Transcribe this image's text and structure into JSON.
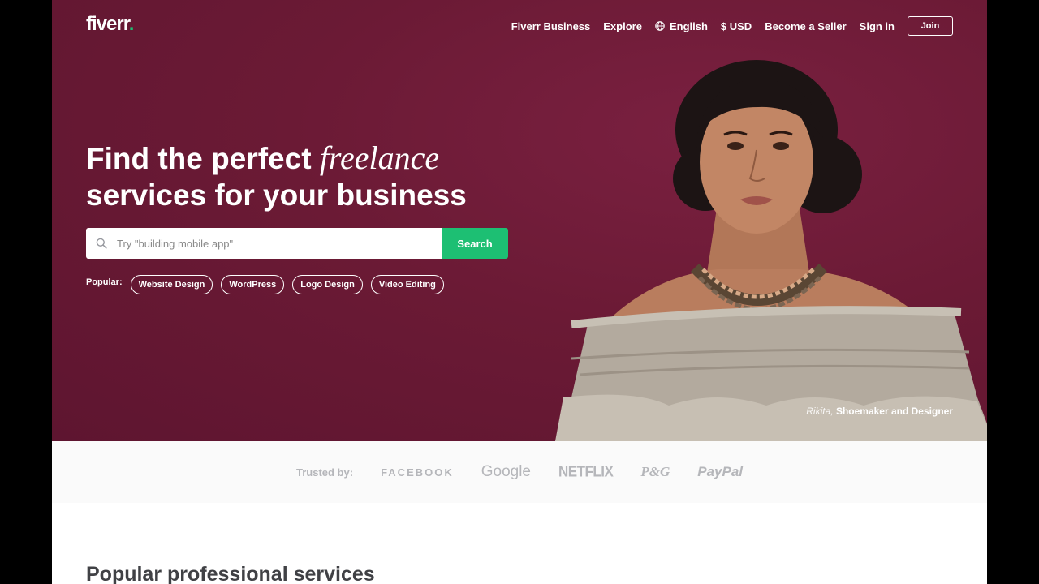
{
  "header": {
    "logo_text": "fiverr",
    "logo_dot": ".",
    "nav": [
      "Fiverr Business",
      "Explore",
      "English",
      "$ USD",
      "Become a Seller",
      "Sign in"
    ],
    "join_label": "Join"
  },
  "hero": {
    "headline_part1": "Find the perfect ",
    "headline_italic": "freelance",
    "headline_part2": "services for your business",
    "search": {
      "placeholder": "Try \"building mobile app\"",
      "button_label": "Search"
    },
    "popular_label": "Popular:",
    "popular_tags": [
      "Website Design",
      "WordPress",
      "Logo Design",
      "Video Editing"
    ],
    "caption_name": "Rikita,",
    "caption_role": "Shoemaker and Designer"
  },
  "trusted": {
    "label": "Trusted by:",
    "brands": [
      "FACEBOOK",
      "Google",
      "NETFLIX",
      "P&G",
      "PayPal"
    ]
  },
  "sections": {
    "popular_services_title": "Popular professional services"
  },
  "colors": {
    "hero_bg": "#6b1a35",
    "accent_green": "#1dbf73",
    "text_dark": "#404145",
    "trusted_gray": "#b5b6ba"
  }
}
